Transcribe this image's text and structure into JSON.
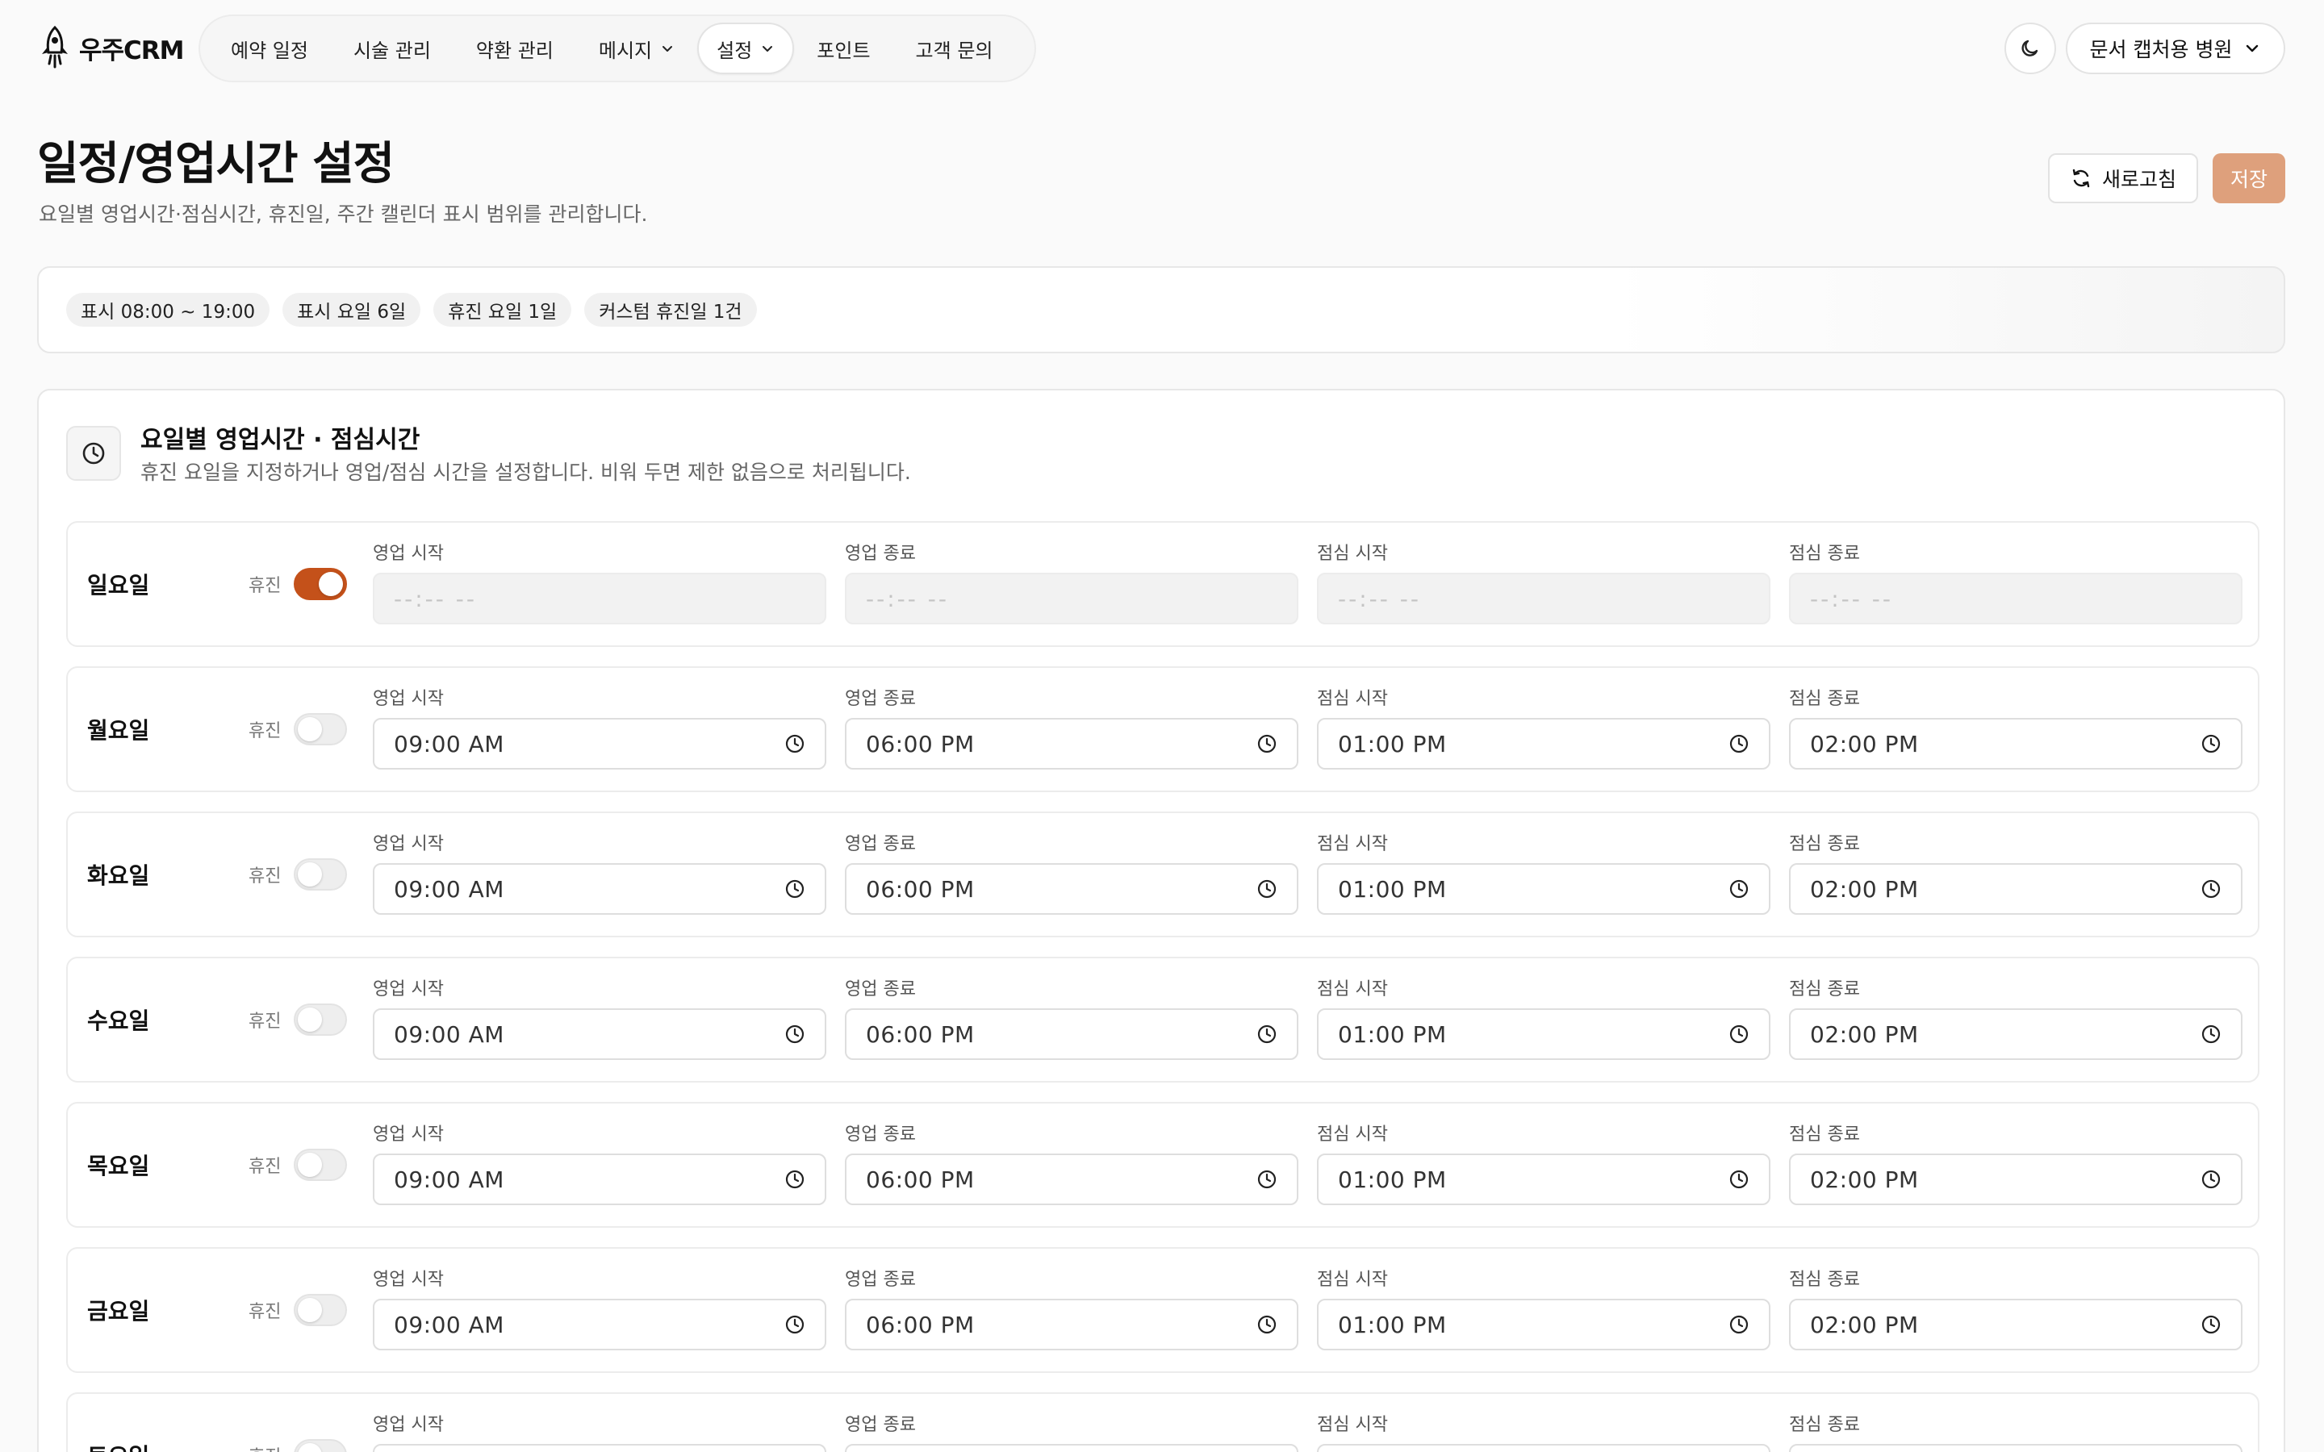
{
  "logo": {
    "text": "우주CRM",
    "icon": "rocket-icon"
  },
  "nav": [
    {
      "label": "예약 일정",
      "active": false,
      "has_dropdown": false
    },
    {
      "label": "시술 관리",
      "active": false,
      "has_dropdown": false
    },
    {
      "label": "약환 관리",
      "active": false,
      "has_dropdown": false
    },
    {
      "label": "메시지",
      "active": false,
      "has_dropdown": true
    },
    {
      "label": "설정",
      "active": true,
      "has_dropdown": true
    },
    {
      "label": "포인트",
      "active": false,
      "has_dropdown": false
    },
    {
      "label": "고객 문의",
      "active": false,
      "has_dropdown": false
    }
  ],
  "header": {
    "theme_icon": "moon-icon",
    "hospital_selector": "문서 캡처용 병원"
  },
  "page": {
    "title": "일정/영업시간 설정",
    "subtitle": "요일별 영업시간·점심시간, 휴진일, 주간 캘린더 표시 범위를 관리합니다.",
    "refresh_label": "새로고침",
    "save_label": "저장"
  },
  "summary_chips": [
    "표시 08:00 ~ 19:00",
    "표시 요일 6일",
    "휴진 요일 1일",
    "커스텀 휴진일 1건"
  ],
  "hours_section": {
    "title": "요일별 영업시간 · 점심시간",
    "description": "휴진 요일을 지정하거나 영업/점심 시간을 설정합니다. 비워 두면 제한 없음으로 처리됩니다.",
    "icon": "clock-icon",
    "off_label": "휴진",
    "field_labels": [
      "영업 시작",
      "영업 종료",
      "점심 시작",
      "점심 종료"
    ],
    "empty_placeholder": "--:-- --",
    "days": [
      {
        "name": "일요일",
        "closed": true,
        "values": [
          "",
          "",
          "",
          ""
        ]
      },
      {
        "name": "월요일",
        "closed": false,
        "values": [
          "09:00 AM",
          "06:00 PM",
          "01:00 PM",
          "02:00 PM"
        ]
      },
      {
        "name": "화요일",
        "closed": false,
        "values": [
          "09:00 AM",
          "06:00 PM",
          "01:00 PM",
          "02:00 PM"
        ]
      },
      {
        "name": "수요일",
        "closed": false,
        "values": [
          "09:00 AM",
          "06:00 PM",
          "01:00 PM",
          "02:00 PM"
        ]
      },
      {
        "name": "목요일",
        "closed": false,
        "values": [
          "09:00 AM",
          "06:00 PM",
          "01:00 PM",
          "02:00 PM"
        ]
      },
      {
        "name": "금요일",
        "closed": false,
        "values": [
          "09:00 AM",
          "06:00 PM",
          "01:00 PM",
          "02:00 PM"
        ]
      },
      {
        "name": "토요일",
        "closed": false,
        "values": [
          "",
          "",
          "",
          ""
        ]
      }
    ]
  }
}
